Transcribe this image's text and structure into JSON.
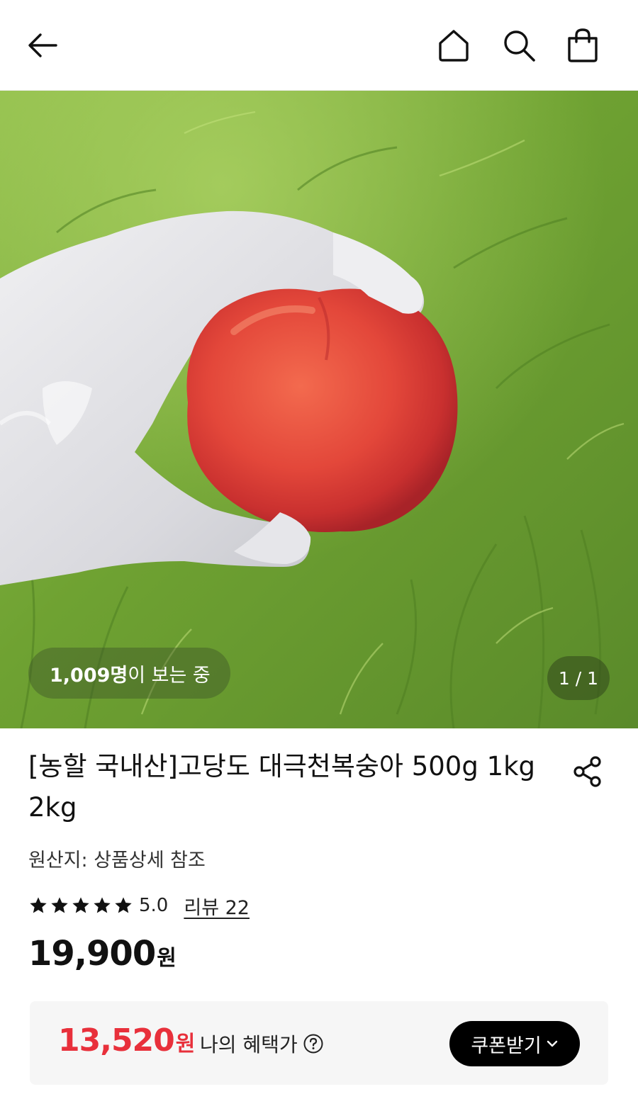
{
  "header": {
    "back_icon": "arrow-left-icon",
    "home_icon": "home-icon",
    "search_icon": "search-icon",
    "cart_icon": "shopping-bag-icon"
  },
  "gallery": {
    "viewers_count": "1,009명",
    "viewers_suffix": "이 보는 중",
    "page_indicator": "1 / 1"
  },
  "product": {
    "title": "[농할 국내산]고당도 대극천복숭아 500g 1kg 2kg",
    "origin": "원산지: 상품상세 참조",
    "rating": {
      "stars": 5,
      "max_stars": 5,
      "value": "5.0",
      "review_label": "리뷰 22"
    },
    "price": {
      "amount": "19,900",
      "unit": "원"
    },
    "share_icon": "share-icon"
  },
  "benefit": {
    "amount": "13,520",
    "unit": "원",
    "label": "나의 혜택가",
    "help_icon": "question-circle-icon",
    "coupon_button": "쿠폰받기",
    "coupon_icon": "chevron-down-icon"
  },
  "colors": {
    "accent_red": "#e8303b",
    "button_black": "#000000",
    "benefit_bg": "#f6f6f6"
  }
}
